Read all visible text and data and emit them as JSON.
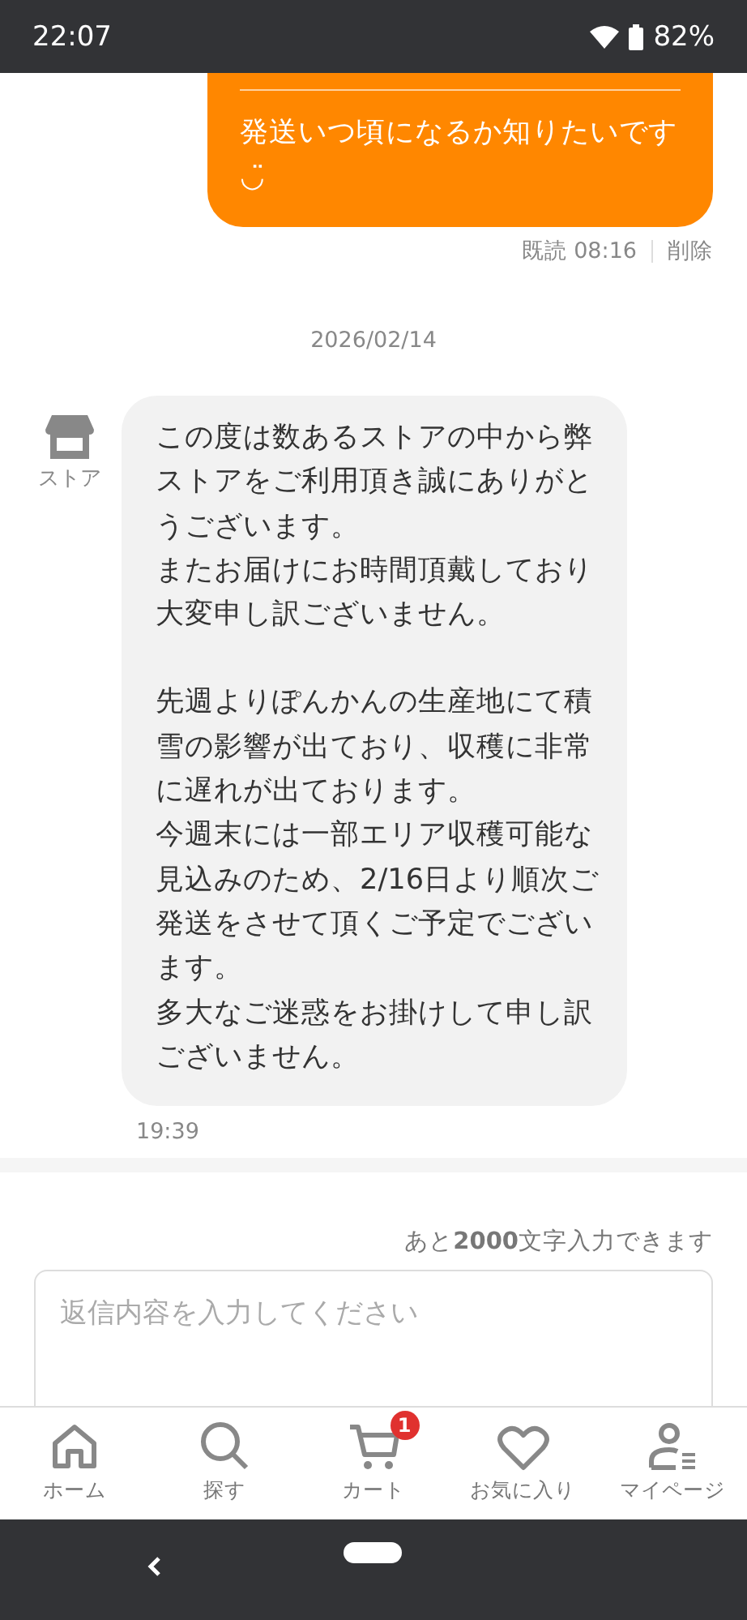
{
  "status_bar": {
    "time": "22:07",
    "battery": "82%"
  },
  "messages": [
    {
      "kind": "sent",
      "text": "発送いつ頃になるか知りたいです\n◡̈",
      "read_label": "既読",
      "time": "08:16",
      "delete_label": "削除"
    },
    {
      "kind": "date",
      "text": "2026/02/14"
    },
    {
      "kind": "received",
      "sender": "ストア",
      "paragraphs": [
        [
          "この度は数あるストアの中から弊",
          "ストアをご利用頂き誠にありがと",
          "うございます。",
          "またお届けにお時間頂戴しており",
          "大変申し訳ございません。"
        ],
        [
          "先週よりぽんかんの生産地にて積",
          "雪の影響が出ており、収穫に非常",
          "に遅れが出ております。",
          "今週末には一部エリア収穫可能な",
          "見込みのため、2/16日より順次ご",
          "発送をさせて頂くご予定でござい",
          "ます。",
          "多大なご迷惑をお掛けして申し訳",
          "ございません。"
        ]
      ],
      "time": "19:39"
    }
  ],
  "composer": {
    "counter": "あと**2000**文字入力できます",
    "placeholder": "返信内容を入力してください"
  },
  "tab_bar": [
    {
      "kind": "home",
      "label": "ホーム"
    },
    {
      "kind": "search",
      "label": "探す"
    },
    {
      "kind": "cart",
      "label": "カート",
      "badge": "1"
    },
    {
      "kind": "favorite",
      "label": "お気に入り"
    },
    {
      "kind": "mypage",
      "label": "マイページ"
    }
  ]
}
